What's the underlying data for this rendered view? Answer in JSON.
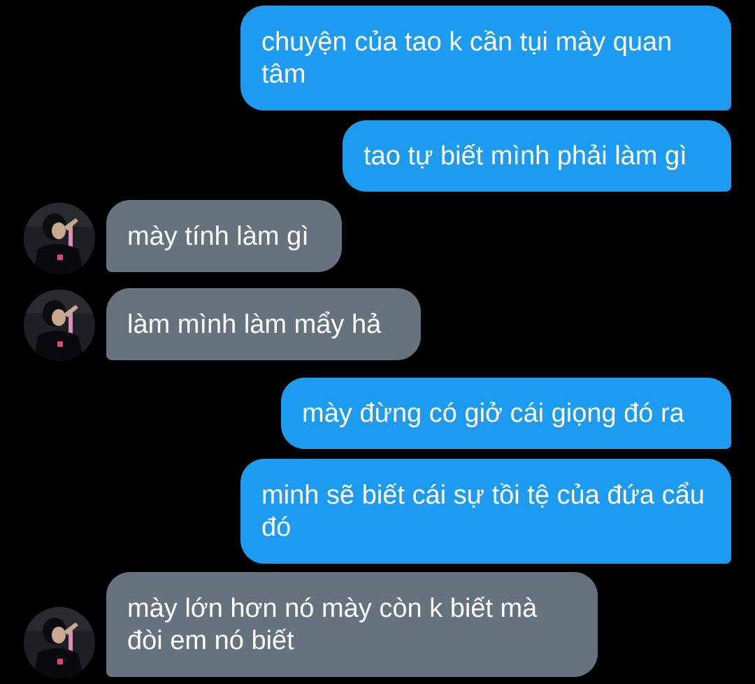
{
  "colors": {
    "background": "#000000",
    "sent_bubble": "#1d9bf0",
    "received_bubble": "#67727f",
    "text": "#ffffff"
  },
  "avatar_icon": "user-avatar-photo",
  "messages": [
    {
      "direction": "sent",
      "text": "chuyện của tao k cần tụi mày quan tâm"
    },
    {
      "direction": "sent",
      "text": "tao tự biết mình phải làm gì"
    },
    {
      "direction": "received",
      "text": "mày tính làm gì"
    },
    {
      "direction": "received",
      "text": "làm mình làm mẩy hả"
    },
    {
      "direction": "sent",
      "text": "mày đừng có giở cái giọng đó ra"
    },
    {
      "direction": "sent",
      "text": "minh sẽ biết cái sự tồi tệ của đứa cẩu đó"
    },
    {
      "direction": "received",
      "text": "mày lớn hơn nó mày còn k biết mà đòi em nó biết"
    }
  ]
}
